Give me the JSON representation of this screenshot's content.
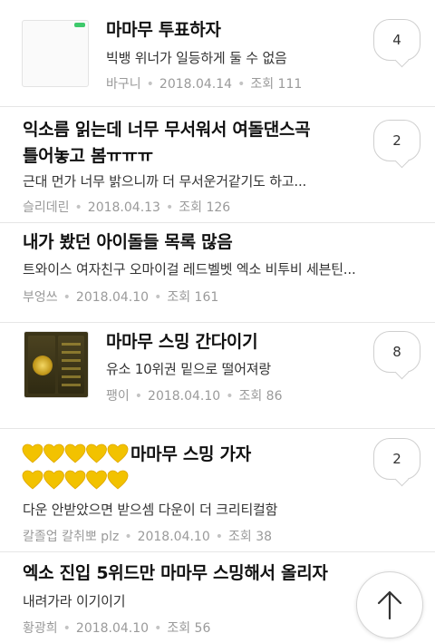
{
  "posts": [
    {
      "title": "마마무 투표하자",
      "preview": "빅뱅 위너가 일등하게 둘 수 없음",
      "author": "바구니",
      "date": "2018.04.14",
      "views": "조회 111",
      "comments": "4"
    },
    {
      "title_line1": "익소름 읽는데 너무 무서워서 여돌댄스곡",
      "title_line2": "틀어놓고 봄ㅠㅠㅠ",
      "preview": "근대 먼가 너무 밝으니까 더 무서운거같기도 하고...",
      "author": "슬리데린",
      "date": "2018.04.13",
      "views": "조회 126",
      "comments": "2"
    },
    {
      "title": "내가 봤던 아이돌들 목록 많음",
      "preview": "트와이스 여자친구 오마이걸 레드벨벳 엑소 비투비 세븐틴...",
      "author": "부엉쓰",
      "date": "2018.04.10",
      "views": "조회 161"
    },
    {
      "title": "마마무 스밍 간다이기",
      "preview": "유소 10위권 밑으로 떨어져랑",
      "author": "팽이",
      "date": "2018.04.10",
      "views": "조회 86",
      "comments": "8"
    },
    {
      "title_line1_text": "마마무 스밍 가자",
      "preview": "다운 안받았으면 받으셈 다운이 더 크리티컬함",
      "author": "칼졸업 칼취뽀 plz",
      "date": "2018.04.10",
      "views": "조회 38",
      "comments": "2"
    },
    {
      "title": "엑소 진입 5위드만 마마무 스밍해서 올리자",
      "preview": "내려가라 이기이기",
      "author": "황광희",
      "date": "2018.04.10",
      "views": "조회 56"
    }
  ],
  "heart_color": "#f2c200",
  "icons": {
    "scroll_top": "arrow-up-icon",
    "heart": "yellow-heart-icon"
  }
}
